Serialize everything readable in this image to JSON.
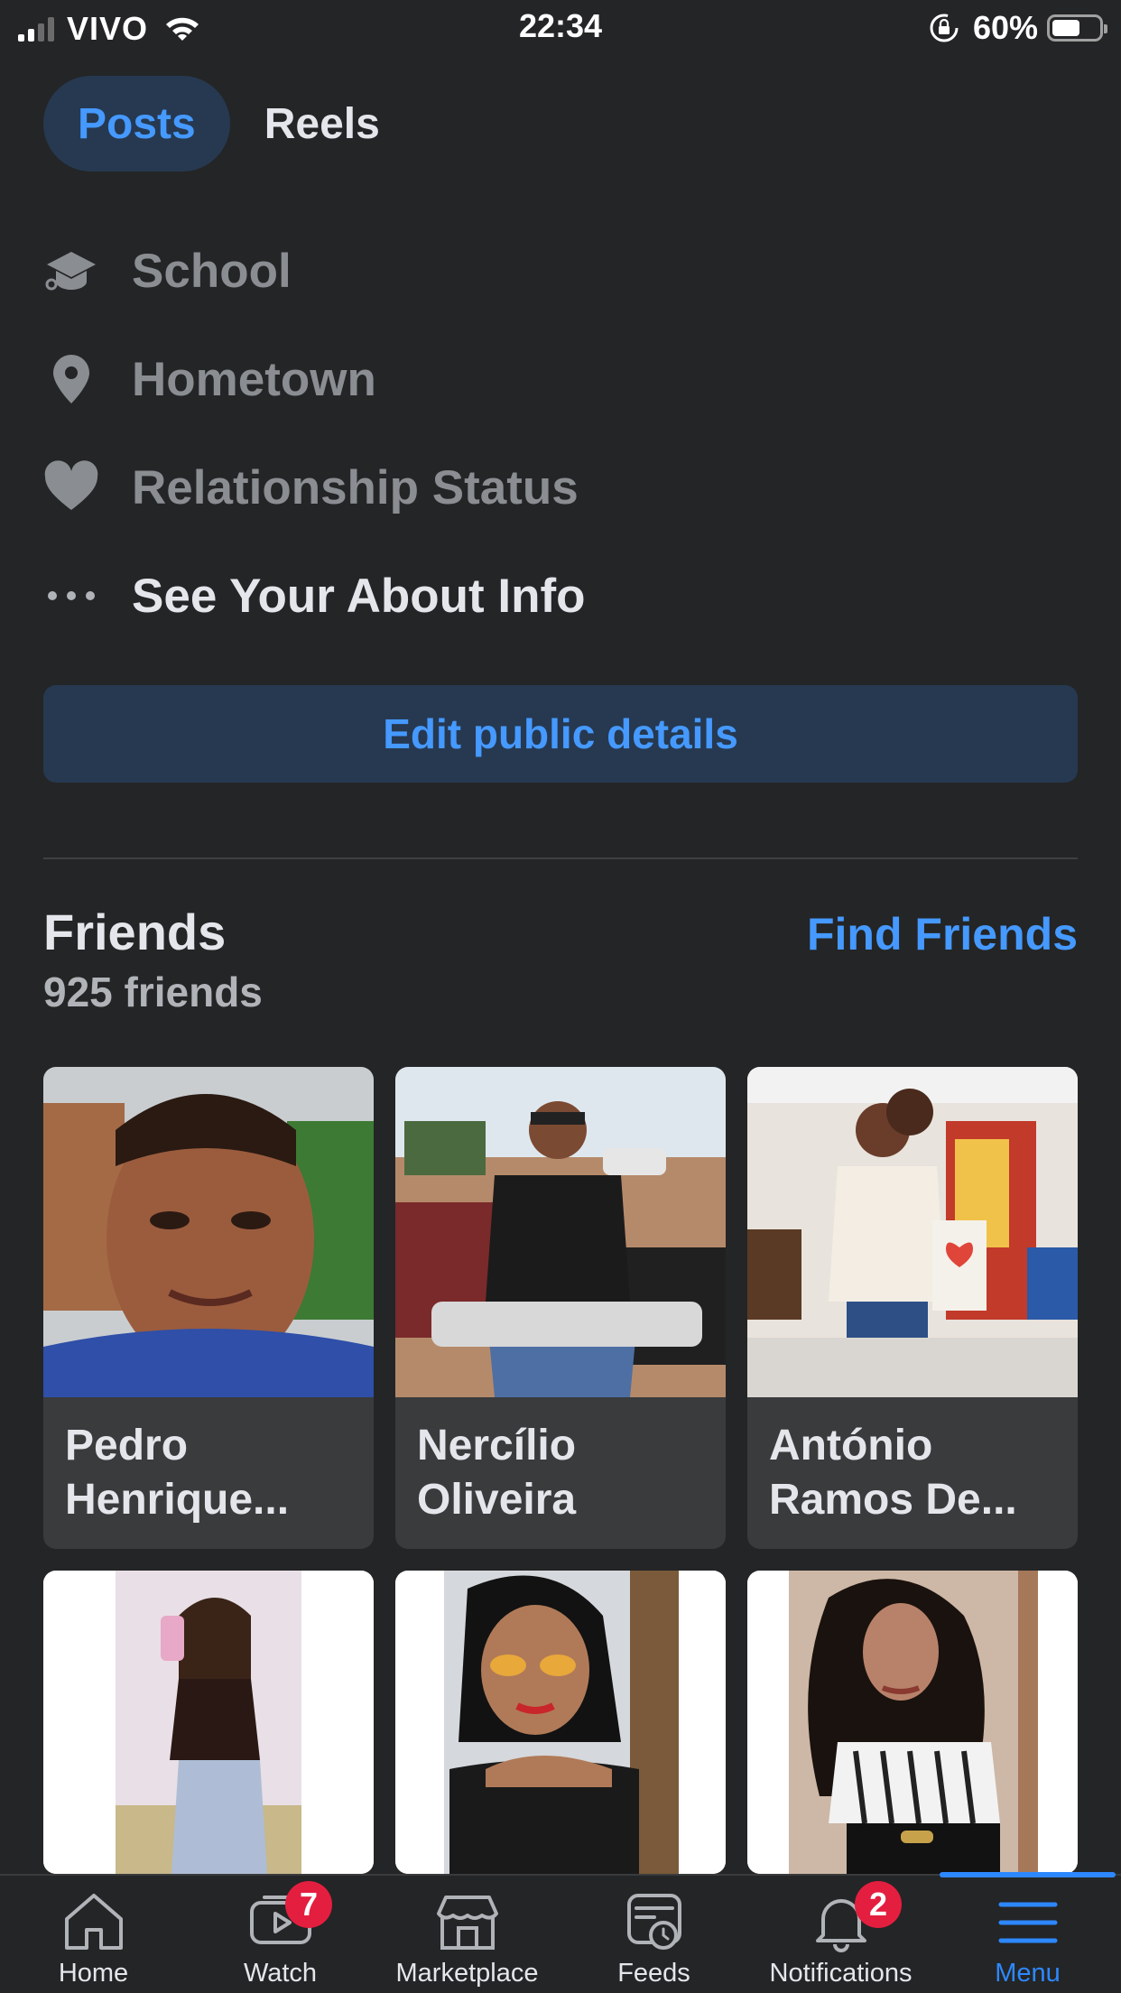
{
  "status_bar": {
    "carrier": "VIVO",
    "time": "22:34",
    "battery": "60%",
    "battery_level": 0.6,
    "icons": [
      "signal-icon",
      "wifi-icon",
      "rotation-lock-icon",
      "battery-icon"
    ]
  },
  "tabs": [
    {
      "label": "Posts",
      "active": true
    },
    {
      "label": "Reels",
      "active": false
    }
  ],
  "about": {
    "items": [
      {
        "label": "School",
        "icon": "graduation-cap-icon"
      },
      {
        "label": "Hometown",
        "icon": "location-pin-icon"
      },
      {
        "label": "Relationship Status",
        "icon": "heart-icon"
      },
      {
        "label": "See Your About Info",
        "icon": "more-dots-icon"
      }
    ],
    "edit_button": "Edit public details"
  },
  "friends": {
    "title": "Friends",
    "count": "925 friends",
    "find_friends": "Find Friends",
    "cards": [
      {
        "name": "Pedro\nHenrique..."
      },
      {
        "name": "Nercílio\nOliveira"
      },
      {
        "name": "António\nRamos De..."
      },
      {
        "name": ""
      },
      {
        "name": ""
      },
      {
        "name": ""
      }
    ]
  },
  "bottom_nav": {
    "items": [
      {
        "label": "Home",
        "icon": "home-icon",
        "badge": null,
        "active": false
      },
      {
        "label": "Watch",
        "icon": "watch-icon",
        "badge": "7",
        "active": false
      },
      {
        "label": "Marketplace",
        "icon": "marketplace-icon",
        "badge": null,
        "active": false
      },
      {
        "label": "Feeds",
        "icon": "feeds-icon",
        "badge": null,
        "active": false
      },
      {
        "label": "Notifications",
        "icon": "bell-icon",
        "badge": "2",
        "active": false
      },
      {
        "label": "Menu",
        "icon": "menu-icon",
        "badge": null,
        "active": true
      }
    ]
  },
  "colors": {
    "background": "#242526",
    "accent": "#4599ff",
    "accent_bg": "#263951",
    "badge": "#e41e3f"
  }
}
